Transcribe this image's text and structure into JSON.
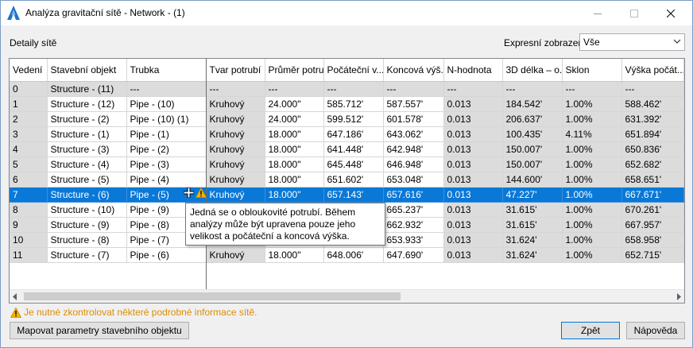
{
  "window": {
    "title": "Analýza gravitační sítě - Network - (1)"
  },
  "top": {
    "details_label": "Detaily sítě",
    "express_label": "Expresní zobrazení",
    "express_value": "Vše"
  },
  "grid": {
    "columns": [
      "Vedení",
      "Stavební objekt",
      "Trubka",
      "Tvar potrubí",
      "Průměr potrubí",
      "Počáteční v...",
      "Koncová výš...",
      "N-hodnota",
      "3D délka – o...",
      "Sklon",
      "Výška počát..."
    ],
    "rows": [
      [
        "0",
        "Structure - (11)",
        "---",
        "---",
        "---",
        "---",
        "---",
        "---",
        "---",
        "---",
        "---"
      ],
      [
        "1",
        "Structure - (12)",
        "Pipe - (10)",
        "Kruhový",
        "24.000\"",
        "585.712'",
        "587.557'",
        "0.013",
        "184.542'",
        "1.00%",
        "588.462'"
      ],
      [
        "2",
        "Structure - (2)",
        "Pipe - (10) (1)",
        "Kruhový",
        "24.000\"",
        "599.512'",
        "601.578'",
        "0.013",
        "206.637'",
        "1.00%",
        "631.392'"
      ],
      [
        "3",
        "Structure - (1)",
        "Pipe - (1)",
        "Kruhový",
        "18.000\"",
        "647.186'",
        "643.062'",
        "0.013",
        "100.435'",
        "4.11%",
        "651.894'"
      ],
      [
        "4",
        "Structure - (3)",
        "Pipe - (2)",
        "Kruhový",
        "18.000\"",
        "641.448'",
        "642.948'",
        "0.013",
        "150.007'",
        "1.00%",
        "650.836'"
      ],
      [
        "5",
        "Structure - (4)",
        "Pipe - (3)",
        "Kruhový",
        "18.000\"",
        "645.448'",
        "646.948'",
        "0.013",
        "150.007'",
        "1.00%",
        "652.682'"
      ],
      [
        "6",
        "Structure - (5)",
        "Pipe - (4)",
        "Kruhový",
        "18.000\"",
        "651.602'",
        "653.048'",
        "0.013",
        "144.600'",
        "1.00%",
        "658.651'"
      ],
      [
        "7",
        "Structure - (6)",
        "Pipe - (5)",
        "Kruhový",
        "18.000\"",
        "657.143'",
        "657.616'",
        "0.013",
        "47.227'",
        "1.00%",
        "667.671'"
      ],
      [
        "8",
        "Structure - (10)",
        "Pipe - (9)",
        "",
        "",
        "",
        "665.237'",
        "0.013",
        "31.615'",
        "1.00%",
        "670.261'"
      ],
      [
        "9",
        "Structure - (9)",
        "Pipe - (8)",
        "",
        "",
        "",
        "662.932'",
        "0.013",
        "31.615'",
        "1.00%",
        "667.957'"
      ],
      [
        "10",
        "Structure - (8)",
        "Pipe - (7)",
        "",
        "",
        "",
        "653.933'",
        "0.013",
        "31.624'",
        "1.00%",
        "658.958'"
      ],
      [
        "11",
        "Structure - (7)",
        "Pipe - (6)",
        "Kruhový",
        "18.000\"",
        "648.006'",
        "647.690'",
        "0.013",
        "31.624'",
        "1.00%",
        "652.715'"
      ]
    ],
    "selected_row": 7
  },
  "tooltip": {
    "text": "Jedná se o obloukovité potrubí. Během analýzy může být upravena pouze jeho velikost a počáteční a koncová výška."
  },
  "footer": {
    "warning": "Je nutné zkontrolovat některé podrobné informace sítě.",
    "map_button": "Mapovat parametry stavebního objektu",
    "back_button": "Zpět",
    "help_button": "Nápověda"
  },
  "colors": {
    "selection": "#0a78d7",
    "warning": "#e08c00",
    "readonly_cell": "#dcdcdc"
  }
}
